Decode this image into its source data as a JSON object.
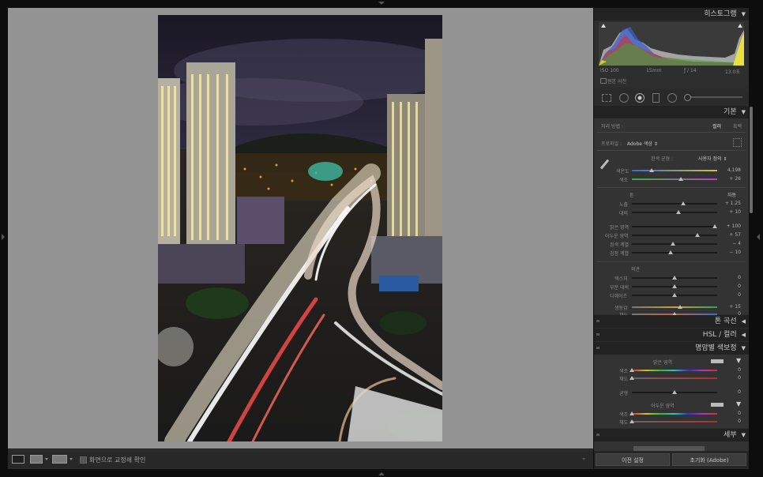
{
  "histogram": {
    "title": "히스토그램",
    "iso": "ISO 100",
    "focal": "15mm",
    "aperture": "ƒ / 14",
    "shutter": "13.0초",
    "original_photo": "원본 사진"
  },
  "basic": {
    "title": "기본",
    "treatment_label": "처리 방법 :",
    "treatment_color": "컬러",
    "treatment_bw": "흑백",
    "profile_label": "프로파일 :",
    "profile_value": "Adobe 색상 ⇕",
    "wb_label": "흰색 균형 :",
    "wb_value": "사용자 정의 ⇕",
    "temp": {
      "label": "색온도",
      "value": "4,198",
      "level": 0.23
    },
    "tint": {
      "label": "색조",
      "value": "+ 26",
      "level": 0.58
    },
    "tone_title": "톤",
    "auto": "자동",
    "exposure": {
      "label": "노출",
      "value": "+ 1.25",
      "level": 0.6
    },
    "contrast": {
      "label": "대비",
      "value": "+ 10",
      "level": 0.54
    },
    "highlights": {
      "label": "밝은 영역",
      "value": "+ 100",
      "level": 0.97
    },
    "shadows": {
      "label": "어두운 영역",
      "value": "+ 57",
      "level": 0.77
    },
    "whites": {
      "label": "흰색 계열",
      "value": "− 4",
      "level": 0.48
    },
    "blacks": {
      "label": "검정 계열",
      "value": "− 10",
      "level": 0.45
    },
    "presence_title": "외관",
    "texture": {
      "label": "텍스처",
      "value": "0",
      "level": 0.5
    },
    "clarity": {
      "label": "부분 대비",
      "value": "0",
      "level": 0.5
    },
    "dehaze": {
      "label": "디헤이즈",
      "value": "0",
      "level": 0.5
    },
    "vibrance": {
      "label": "생동감",
      "value": "+ 15",
      "level": 0.57
    },
    "saturation": {
      "label": "채도",
      "value": "0",
      "level": 0.5
    }
  },
  "tone_curve": {
    "title": "톤 곡선"
  },
  "hsl": {
    "title": "HSL / 컬러"
  },
  "split_toning": {
    "title": "명암별 색보정",
    "highlights_title": "밝은 영역",
    "hl_hue": {
      "label": "색조",
      "value": "0",
      "level": 0.0
    },
    "hl_sat": {
      "label": "채도",
      "value": "0",
      "level": 0.0
    },
    "balance": {
      "label": "균형",
      "value": "0",
      "level": 0.5
    },
    "shadows_title": "어두운 영역",
    "sh_hue": {
      "label": "색조",
      "value": "0",
      "level": 0.0
    },
    "sh_sat": {
      "label": "채도",
      "value": "0",
      "level": 0.0
    }
  },
  "detail": {
    "title": "세부"
  },
  "buttons": {
    "previous": "이전 설정",
    "reset": "초기화 (Adobe)"
  },
  "toolbar": {
    "soft_proof": "화면으로 교정쇄 확인"
  }
}
